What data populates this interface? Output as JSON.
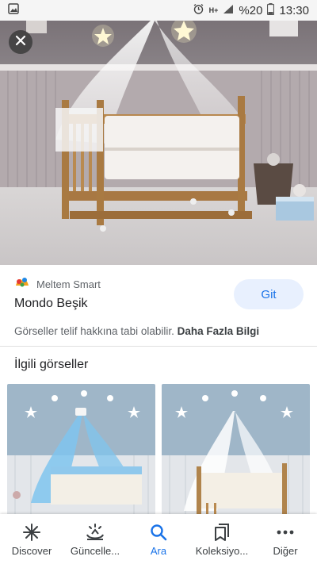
{
  "status_bar": {
    "battery": "%20",
    "time": "13:30",
    "network": "H+"
  },
  "source": {
    "name": "Meltem Smart"
  },
  "result": {
    "title": "Mondo Beşik",
    "visit_label": "Git"
  },
  "copyright": {
    "text": "Görseller telif hakkına tabi olabilir.",
    "more_label": "Daha Fazla Bilgi"
  },
  "related": {
    "title": "İlgili görseller"
  },
  "bottom_nav": {
    "items": [
      {
        "label": "Discover"
      },
      {
        "label": "Güncelle..."
      },
      {
        "label": "Ara"
      },
      {
        "label": "Koleksiyo..."
      },
      {
        "label": "Diğer"
      }
    ]
  },
  "colors": {
    "accent": "#1a73e8",
    "visit_bg": "#e8f0fe"
  }
}
